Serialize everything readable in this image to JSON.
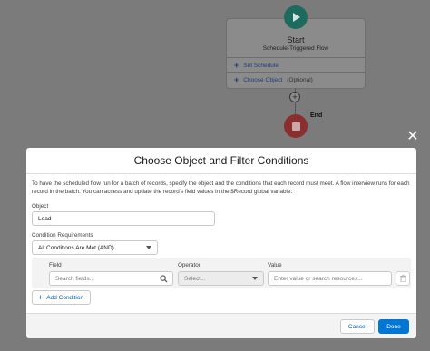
{
  "flow": {
    "start_title": "Start",
    "start_subtitle": "Schedule-Triggered Flow",
    "set_schedule_label": "Set Schedule",
    "choose_object_label": "Choose Object",
    "choose_object_optional": "(Optional)",
    "add_symbol": "+",
    "end_label": "End"
  },
  "modal": {
    "close_symbol": "✕",
    "title": "Choose Object and Filter Conditions",
    "description": "To have the scheduled flow run for a batch of records, specify the object and the conditions that each record must meet. A flow interview runs for each record in the batch. You can access and update the record's field values in the $Record global variable.",
    "object_label": "Object",
    "object_value": "Lead",
    "condition_requirements_label": "Condition Requirements",
    "condition_requirements_value": "All Conditions Are Met (AND)",
    "condition_row": {
      "field_label": "Field",
      "field_placeholder": "Search fields...",
      "operator_label": "Operator",
      "operator_placeholder": "Select...",
      "value_label": "Value",
      "value_placeholder": "Enter value or search resources..."
    },
    "add_condition_label": "Add Condition",
    "add_condition_symbol": "+",
    "cancel_label": "Cancel",
    "done_label": "Done"
  },
  "colors": {
    "accent": "#0176d3",
    "start_icon": "#1d6b5f",
    "end_icon": "#8b2e2e"
  }
}
